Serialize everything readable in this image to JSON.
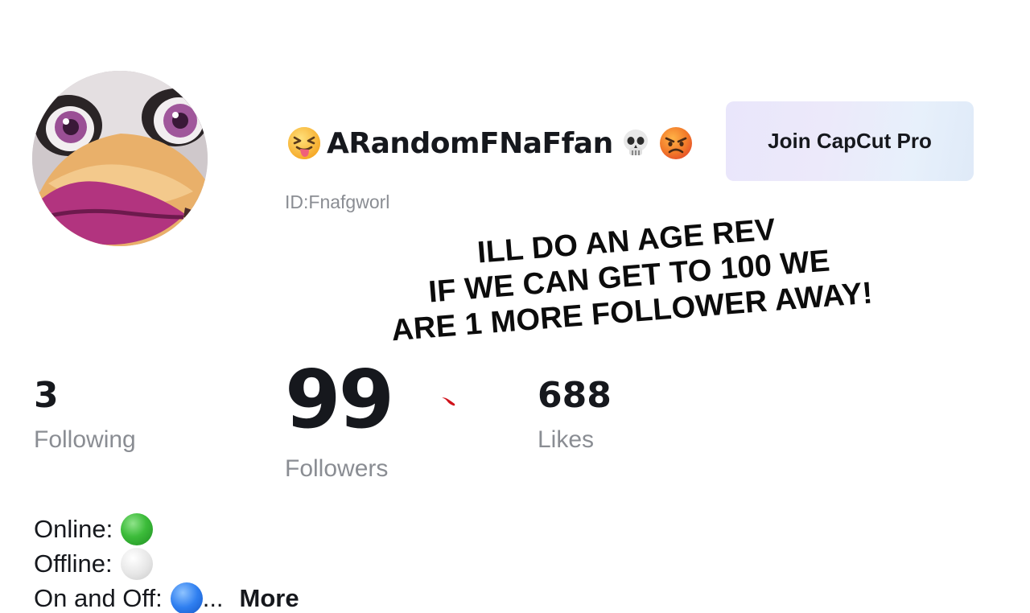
{
  "profile": {
    "username": "ARandomFNaFfan",
    "user_id": "ID:Fnafgworl",
    "name_emojis": {
      "leading": "squinting-tongue-face-emoji",
      "trailing": [
        "skull-emoji",
        "angry-face-emoji"
      ]
    },
    "avatar": "animatronic-chicken-face"
  },
  "pro_button": {
    "label": "Join CapCut Pro"
  },
  "caption": {
    "lines": [
      "ILL DO AN AGE REV",
      "IF WE CAN GET TO 100 WE",
      "ARE 1 MORE FOLLOWER AWAY!"
    ]
  },
  "stats": {
    "following": {
      "value": "3",
      "label": "Following"
    },
    "followers": {
      "value": "99",
      "label": "Followers"
    },
    "likes": {
      "value": "688",
      "label": "Likes"
    }
  },
  "bio": {
    "lines": [
      {
        "text": "Online:",
        "status": "green-circle"
      },
      {
        "text": "Offline:",
        "status": "white-circle"
      },
      {
        "text": "On and Off:",
        "status": "blue-circle",
        "suffix": "..."
      }
    ],
    "more_label": "More"
  },
  "colors": {
    "text_primary": "#16181d",
    "text_secondary": "#8a8d93",
    "pro_button_bg": "#eae8fa",
    "status_online": "#3cbc3a",
    "status_offline": "#e6e6e6",
    "status_on_off": "#2f7ff0"
  }
}
